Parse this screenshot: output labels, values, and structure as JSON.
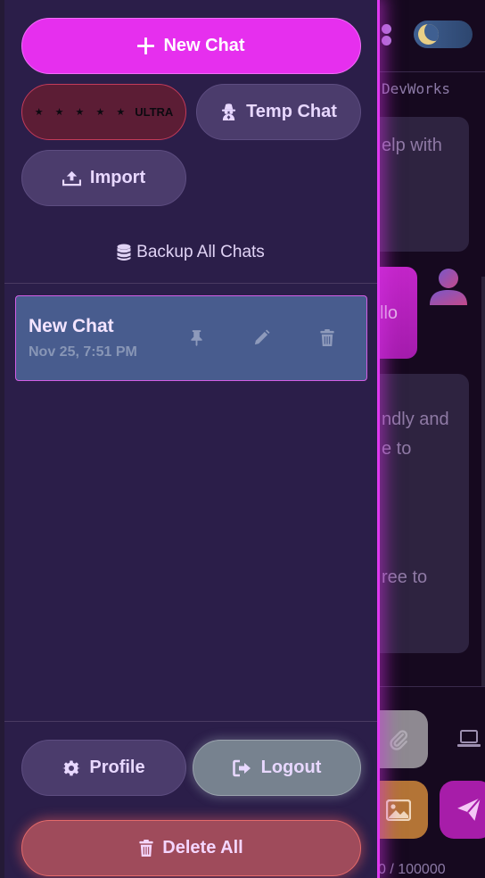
{
  "drawer": {
    "new_chat_label": "New Chat",
    "ultra_stars": "★ ★ ★ ★ ★",
    "ultra_label": "ULTRA",
    "temp_chat_label": "Temp Chat",
    "import_label": "Import",
    "backup_label": "Backup All Chats",
    "chats": [
      {
        "title": "New Chat",
        "date": "Nov 25, 7:51 PM"
      }
    ],
    "profile_label": "Profile",
    "logout_label": "Logout",
    "delete_all_label": "Delete All"
  },
  "background": {
    "brand": "DevWorks",
    "msg1_fragment": "elp with",
    "user_fragment": "llo",
    "msg3_line1": "ndly and",
    "msg3_line2": "e to",
    "msg3_line3": "ree to",
    "counter": "0 / 100000"
  },
  "icons": {
    "new_chat": "plus-icon",
    "temp_chat": "incognito-icon",
    "import": "upload-icon",
    "backup": "database-icon",
    "pin": "pin-icon",
    "edit": "pencil-icon",
    "delete": "trash-icon",
    "profile": "gear-icon",
    "logout": "logout-icon",
    "delete_all": "trash-icon"
  },
  "colors": {
    "accent": "#e62fee",
    "drawer_bg": "#2b1e49",
    "chat_selected": "#485c8e",
    "danger": "#9f4b5b"
  }
}
